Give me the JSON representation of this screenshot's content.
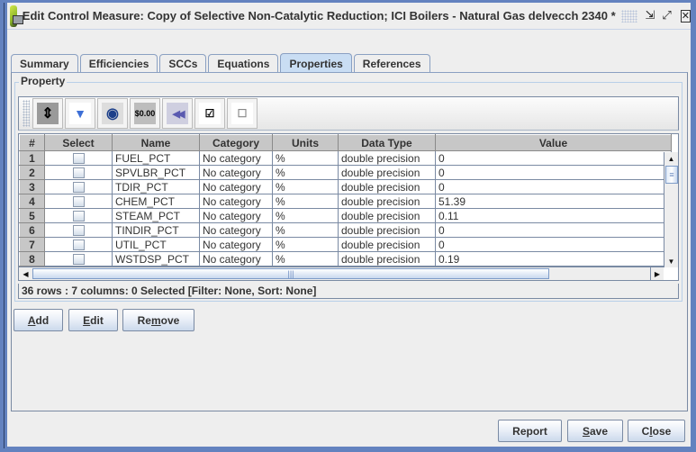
{
  "window": {
    "title": "Edit Control Measure: Copy of Selective Non-Catalytic Reduction; ICI Boilers - Natural Gas delvecch 2340 *",
    "controls": {
      "minimize": "⇲",
      "maximize": "⤢",
      "close": "✕"
    }
  },
  "tabs": [
    {
      "label": "Summary",
      "active": false
    },
    {
      "label": "Efficiencies",
      "active": false
    },
    {
      "label": "SCCs",
      "active": false
    },
    {
      "label": "Equations",
      "active": false
    },
    {
      "label": "Properties",
      "active": true
    },
    {
      "label": "References",
      "active": false
    }
  ],
  "property_panel": {
    "group_label": "Property",
    "toolbar": [
      {
        "name": "sort-columns-icon",
        "glyph": "⇕"
      },
      {
        "name": "filter-icon",
        "glyph": "▼"
      },
      {
        "name": "view-icon",
        "glyph": "◉"
      },
      {
        "name": "format-icon",
        "glyph": "$0.00"
      },
      {
        "name": "reset-icon",
        "glyph": "◀◀"
      },
      {
        "name": "select-all-icon",
        "glyph": "☑"
      },
      {
        "name": "clear-selection-icon",
        "glyph": "☐"
      }
    ],
    "table": {
      "columns": [
        "#",
        "Select",
        "Name",
        "Category",
        "Units",
        "Data Type",
        "Value"
      ],
      "rows": [
        {
          "num": "1",
          "name": "FUEL_PCT",
          "category": "No category",
          "units": "%",
          "data_type": "double precision",
          "value": "0"
        },
        {
          "num": "2",
          "name": "SPVLBR_PCT",
          "category": "No category",
          "units": "%",
          "data_type": "double precision",
          "value": "0"
        },
        {
          "num": "3",
          "name": "TDIR_PCT",
          "category": "No category",
          "units": "%",
          "data_type": "double precision",
          "value": "0"
        },
        {
          "num": "4",
          "name": "CHEM_PCT",
          "category": "No category",
          "units": "%",
          "data_type": "double precision",
          "value": "51.39"
        },
        {
          "num": "5",
          "name": "STEAM_PCT",
          "category": "No category",
          "units": "%",
          "data_type": "double precision",
          "value": "0.11"
        },
        {
          "num": "6",
          "name": "TINDIR_PCT",
          "category": "No category",
          "units": "%",
          "data_type": "double precision",
          "value": "0"
        },
        {
          "num": "7",
          "name": "UTIL_PCT",
          "category": "No category",
          "units": "%",
          "data_type": "double precision",
          "value": "0"
        },
        {
          "num": "8",
          "name": "WSTDSP_PCT",
          "category": "No category",
          "units": "%",
          "data_type": "double precision",
          "value": "0.19"
        }
      ]
    },
    "status": "36 rows : 7 columns: 0 Selected [Filter: None, Sort: None]"
  },
  "buttons": {
    "add": {
      "pre": "",
      "mnemonic": "A",
      "post": "dd"
    },
    "edit": {
      "pre": "",
      "mnemonic": "E",
      "post": "dit"
    },
    "remove": {
      "pre": "Re",
      "mnemonic": "m",
      "post": "ove"
    },
    "report": {
      "label": "Report"
    },
    "save": {
      "pre": "",
      "mnemonic": "S",
      "post": "ave"
    },
    "close": {
      "pre": "C",
      "mnemonic": "l",
      "post": "ose"
    }
  }
}
